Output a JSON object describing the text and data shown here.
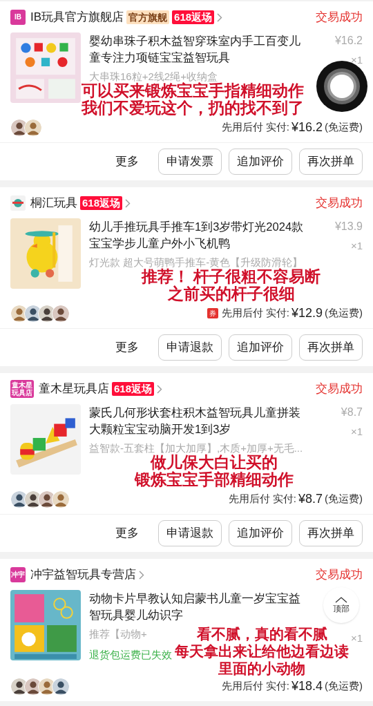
{
  "orders": [
    {
      "shop": {
        "logo": {
          "kind": "text",
          "text": "IB"
        },
        "name": "IB玩具官方旗舰店",
        "tags": [
          {
            "kind": "official",
            "text": "官方旗舰"
          },
          {
            "kind": "promo",
            "text": "618返场"
          }
        ]
      },
      "status": "交易成功",
      "product": {
        "title": "婴幼串珠子积木益智穿珠室内手工百变儿童专注力项链宝宝益智玩具",
        "sku": "大串珠16粒+2线2绳+收纳盒",
        "price": "¥16.2",
        "qty": "×1"
      },
      "ring": true,
      "avatars": [
        {
          "kind": "picture"
        },
        {
          "kind": "picture"
        }
      ],
      "payment": {
        "label": "先用后付 实付:",
        "amount": "¥16.2",
        "shipping": "(免运费)"
      },
      "annotation": [
        "可以买来锻炼宝宝手指精细动作",
        "我们不爱玩这个，扔的找不到了"
      ],
      "buttons": [
        {
          "kind": "plain",
          "label": "更多"
        },
        {
          "kind": "outline",
          "label": "申请发票"
        },
        {
          "kind": "outline",
          "label": "追加评价"
        },
        {
          "kind": "outline",
          "label": "再次拼单"
        }
      ]
    },
    {
      "shop": {
        "logo": {
          "kind": "picture"
        },
        "name": "桐汇玩具",
        "tags": [
          {
            "kind": "promo",
            "text": "618返场"
          }
        ]
      },
      "status": "交易成功",
      "product": {
        "title": "幼儿手推玩具手推车1到3岁带灯光2024款宝宝学步儿童户外小飞机鸭",
        "sku": "灯光款 超大号萌鸭手推车-黄色【升级防滑轮】",
        "price": "¥13.9",
        "qty": "×1"
      },
      "ring": false,
      "avatars": [
        {
          "kind": "picture"
        },
        {
          "kind": "picture"
        },
        {
          "kind": "picture"
        },
        {
          "kind": "picture"
        }
      ],
      "coupon": "券",
      "payment": {
        "label": "先用后付 实付:",
        "amount": "¥12.9",
        "shipping": "(免运费)"
      },
      "annotation": [
        "推荐！ 杆子很粗不容易断",
        "之前买的杆子很细"
      ],
      "buttons": [
        {
          "kind": "plain",
          "label": "更多"
        },
        {
          "kind": "outline",
          "label": "申请退款"
        },
        {
          "kind": "outline",
          "label": "追加评价"
        },
        {
          "kind": "outline",
          "label": "再次拼单"
        }
      ]
    },
    {
      "shop": {
        "logo": {
          "kind": "text",
          "text": "童木星玩具店"
        },
        "name": "童木星玩具店",
        "tags": [
          {
            "kind": "promo",
            "text": "618返场"
          }
        ]
      },
      "status": "交易成功",
      "product": {
        "title": "蒙氏几何形状套柱积木益智玩具儿童拼装大颗粒宝宝动脑开发1到3岁",
        "sku": "益智款-五套柱【加大加厚】,木质+加厚+无毛...",
        "price": "¥8.7",
        "qty": "×1"
      },
      "ring": false,
      "avatars": [
        {
          "kind": "picture"
        },
        {
          "kind": "picture"
        },
        {
          "kind": "picture"
        },
        {
          "kind": "picture"
        }
      ],
      "payment": {
        "label": "先用后付 实付:",
        "amount": "¥8.7",
        "shipping": "(免运费)"
      },
      "annotation": [
        "做儿保大白让买的",
        "锻炼宝宝手部精细动作"
      ],
      "buttons": [
        {
          "kind": "plain",
          "label": "更多"
        },
        {
          "kind": "outline",
          "label": "申请退款"
        },
        {
          "kind": "outline",
          "label": "追加评价"
        },
        {
          "kind": "outline",
          "label": "再次拼单"
        }
      ]
    },
    {
      "shop": {
        "logo": {
          "kind": "text",
          "text": "冲宇"
        },
        "name": "冲宇益智玩具专营店"
      },
      "status": "交易成功",
      "product": {
        "title": "动物卡片早教认知启蒙书儿童一岁宝宝益智玩具婴儿幼识字",
        "sku": "推荐【动物+",
        "qty": "×1",
        "note": "退货包运费已失效"
      },
      "ring": false,
      "avatars": [
        {
          "kind": "picture"
        },
        {
          "kind": "picture"
        },
        {
          "kind": "picture"
        },
        {
          "kind": "picture"
        }
      ],
      "payment": {
        "label": "先用后付 实付:",
        "amount": "¥18.4",
        "shipping": "(免运费)"
      },
      "annotation": [
        "看不腻，真的看不腻",
        "每天拿出来让给他边看边读",
        "里面的小动物"
      ]
    }
  ],
  "back_to_top": {
    "label": "顶部"
  }
}
